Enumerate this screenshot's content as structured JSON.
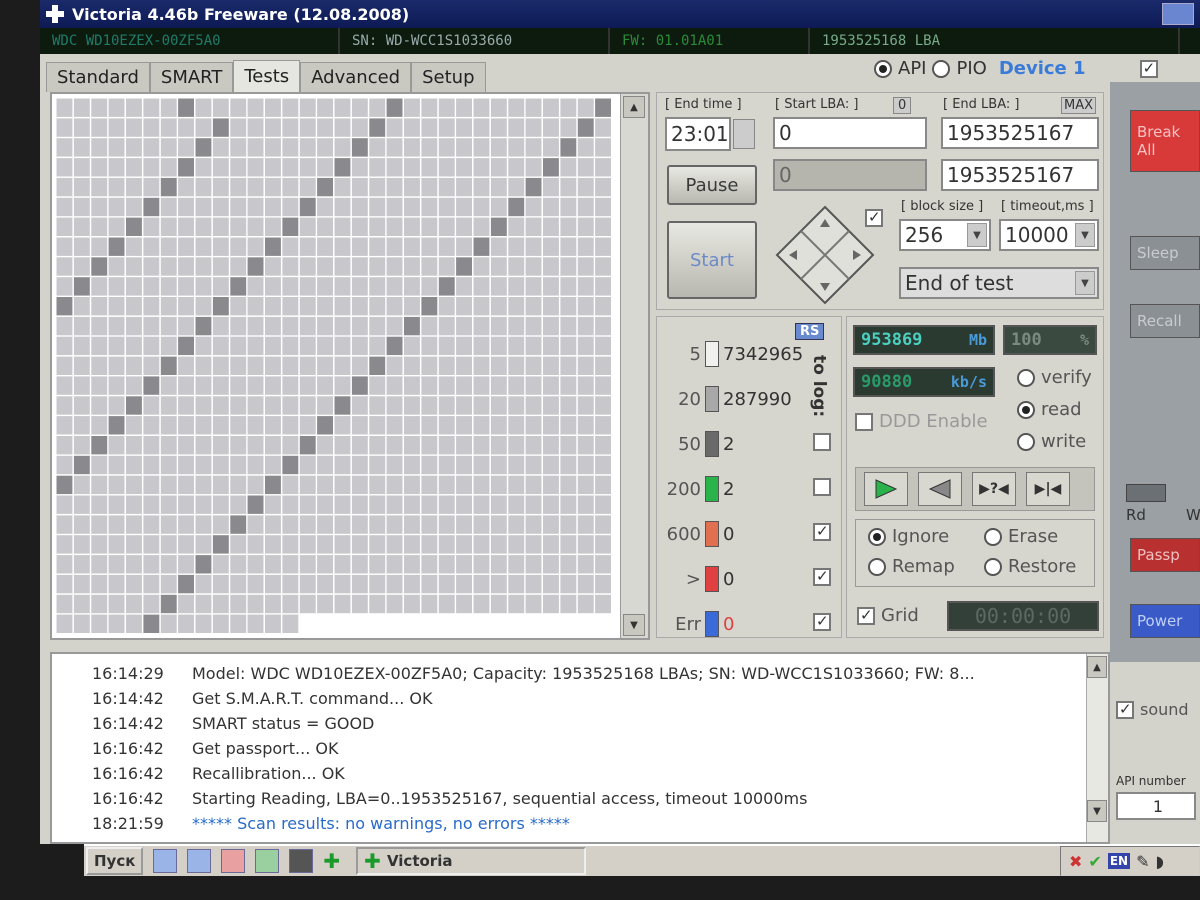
{
  "window": {
    "title": "Victoria 4.46b Freeware (12.08.2008)"
  },
  "drive_info": {
    "model": "WDC WD10EZEX-00ZF5A0",
    "serial": "SN: WD-WCC1S1033660",
    "firmware": "FW: 01.01A01",
    "lba_summary": "1953525168 LBA"
  },
  "tabs": [
    {
      "label": "Standard"
    },
    {
      "label": "SMART"
    },
    {
      "label": "Tests",
      "active": true
    },
    {
      "label": "Advanced"
    },
    {
      "label": "Setup"
    }
  ],
  "interface_mode": {
    "api_label": "API",
    "pio_label": "PIO",
    "selected": "API",
    "device_label": "Device 1"
  },
  "test_params": {
    "end_time_label": "[ End time ]",
    "end_time_value": "23:01",
    "start_lba_label": "[ Start LBA: ]",
    "start_lba_value": "0",
    "start_lba_reset": "0",
    "end_lba_label": "[ End LBA: ]",
    "end_lba_max": "MAX",
    "end_lba_value": "1953525167",
    "current_lba": "0",
    "end_lba_value2": "1953525167",
    "block_size_label": "[ block size ]",
    "block_size_value": "256",
    "timeout_label": "[ timeout,ms ]",
    "timeout_value": "10000",
    "end_action": "End of test",
    "pause_label": "Pause",
    "start_label": "Start"
  },
  "stats": {
    "rs_label": "RS",
    "to_log_label": "to log:",
    "rows": [
      {
        "threshold": "5",
        "count": "7342965",
        "color": "#f0f0ee",
        "logged": false
      },
      {
        "threshold": "20",
        "count": "287990",
        "color": "#a8a8a8",
        "logged": false
      },
      {
        "threshold": "50",
        "count": "2",
        "color": "#6a6a6a",
        "logged": false
      },
      {
        "threshold": "200",
        "count": "2",
        "color": "#2ab34a",
        "logged": false
      },
      {
        "threshold": "600",
        "count": "0",
        "color": "#e07050",
        "logged": true
      },
      {
        "threshold": ">",
        "count": "0",
        "color": "#e04040",
        "logged": true
      },
      {
        "threshold": "Err",
        "count": "0",
        "color": "#3a6ad8",
        "logged": true
      }
    ]
  },
  "speed": {
    "megabytes": "953869",
    "megabytes_unit": "Mb",
    "percent": "100",
    "percent_unit": "%",
    "rate": "90880",
    "rate_unit": "kb/s",
    "ddd_label": "DDD Enable",
    "verify_label": "verify",
    "read_label": "read",
    "write_label": "write",
    "selected_mode": "read",
    "ignore_label": "Ignore",
    "erase_label": "Erase",
    "remap_label": "Remap",
    "restore_label": "Restore",
    "selected_action": "Ignore",
    "grid_label": "Grid",
    "timer": "00:00:00"
  },
  "side": {
    "break_label": "Break All",
    "sleep_label": "Sleep",
    "recall_label": "Recall",
    "rd_label": "Rd",
    "wr_label": "Wr",
    "passp_label": "Passp",
    "power_label": "Power",
    "sound_label": "sound",
    "api_number_label": "API number",
    "api_number_value": "1"
  },
  "log": [
    {
      "time": "16:14:29",
      "text": "Model: WDC WD10EZEX-00ZF5A0; Capacity: 1953525168 LBAs; SN: WD-WCC1S1033660; FW: 8...",
      "highlight": false
    },
    {
      "time": "16:14:42",
      "text": "Get S.M.A.R.T. command... OK",
      "highlight": false
    },
    {
      "time": "16:14:42",
      "text": "SMART status = GOOD",
      "highlight": false
    },
    {
      "time": "16:16:42",
      "text": "Get passport... OK",
      "highlight": false
    },
    {
      "time": "16:16:42",
      "text": "Recallibration... OK",
      "highlight": false
    },
    {
      "time": "16:16:42",
      "text": "Starting Reading, LBA=0..1953525167, sequential access, timeout 10000ms",
      "highlight": false
    },
    {
      "time": "18:21:59",
      "text": "***** Scan results: no warnings, no errors *****",
      "highlight": true
    }
  ],
  "taskbar": {
    "start_label": "Пуск",
    "task_label": "Victoria",
    "lang": "EN"
  },
  "block_map": {
    "cols": 32,
    "rows": 27,
    "filled_rows": 26,
    "last_row_filled_cols": 14,
    "dark_cells": [
      [
        0,
        7
      ],
      [
        0,
        19
      ],
      [
        0,
        31
      ],
      [
        1,
        9
      ],
      [
        1,
        18
      ],
      [
        1,
        30
      ],
      [
        2,
        8
      ],
      [
        2,
        17
      ],
      [
        2,
        29
      ],
      [
        3,
        7
      ],
      [
        3,
        16
      ],
      [
        3,
        28
      ],
      [
        4,
        6
      ],
      [
        4,
        15
      ],
      [
        4,
        27
      ],
      [
        5,
        5
      ],
      [
        5,
        14
      ],
      [
        5,
        26
      ],
      [
        6,
        4
      ],
      [
        6,
        13
      ],
      [
        6,
        25
      ],
      [
        7,
        3
      ],
      [
        7,
        12
      ],
      [
        7,
        24
      ],
      [
        8,
        2
      ],
      [
        8,
        11
      ],
      [
        8,
        23
      ],
      [
        9,
        1
      ],
      [
        9,
        10
      ],
      [
        9,
        22
      ],
      [
        10,
        0
      ],
      [
        10,
        9
      ],
      [
        10,
        21
      ],
      [
        11,
        8
      ],
      [
        11,
        20
      ],
      [
        12,
        7
      ],
      [
        12,
        19
      ],
      [
        13,
        6
      ],
      [
        13,
        18
      ],
      [
        14,
        5
      ],
      [
        14,
        17
      ],
      [
        15,
        4
      ],
      [
        15,
        16
      ],
      [
        16,
        3
      ],
      [
        16,
        15
      ],
      [
        17,
        2
      ],
      [
        17,
        14
      ],
      [
        18,
        1
      ],
      [
        18,
        13
      ],
      [
        19,
        0
      ],
      [
        19,
        12
      ],
      [
        20,
        11
      ],
      [
        21,
        10
      ],
      [
        22,
        9
      ],
      [
        23,
        8
      ],
      [
        24,
        7
      ],
      [
        25,
        6
      ],
      [
        26,
        5
      ]
    ]
  }
}
